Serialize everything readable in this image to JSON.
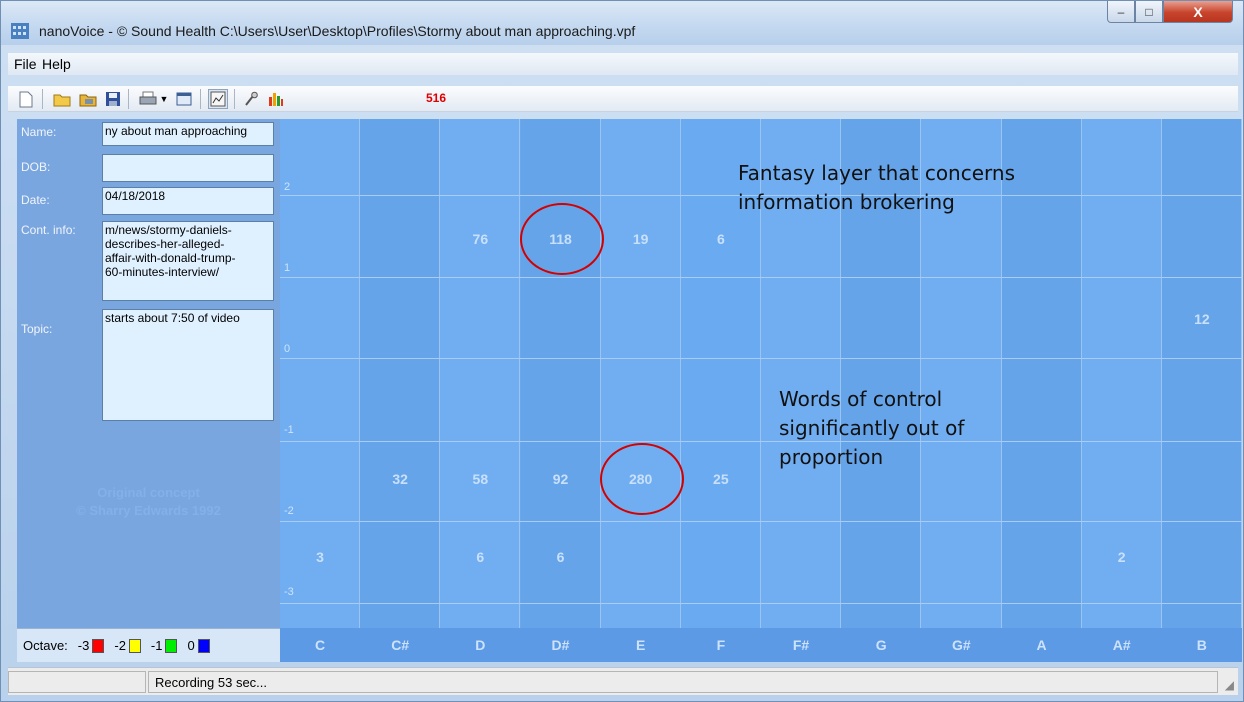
{
  "window": {
    "title": "nanoVoice - © Sound Health C:\\Users\\User\\Desktop\\Profiles\\Stormy about man approaching.vpf",
    "min_symbol": "–",
    "max_symbol": "□",
    "close_symbol": "X"
  },
  "menu": {
    "file": "File",
    "help": "Help"
  },
  "toolbar": {
    "count": "516",
    "icons": [
      "new-icon",
      "open-icon",
      "open-folder-icon",
      "save-icon",
      "print-icon",
      "dropdown-icon",
      "window-icon",
      "chart-view-icon",
      "microphone-icon",
      "bar-chart-icon"
    ]
  },
  "profile": {
    "labels": {
      "name": "Name:",
      "dob": "DOB:",
      "date": "Date:",
      "cont": "Cont. info:",
      "topic": "Topic:"
    },
    "name": "ny about man approaching",
    "dob": "",
    "date": "04/18/2018",
    "cont_info": "m/news/stormy-daniels-\ndescribes-her-alleged-\naffair-with-donald-trump-\n60-minutes-interview/",
    "topic": "starts about 7:50 of video",
    "concept_line1": "Original concept",
    "concept_line2": "© Sharry Edwards 1992"
  },
  "octave": {
    "label": "Octave:",
    "items": [
      {
        "label": "-3",
        "color": "#ff0000"
      },
      {
        "label": "-2",
        "color": "#ffff00"
      },
      {
        "label": "-1",
        "color": "#00ee00"
      },
      {
        "label": "0",
        "color": "#0000ff"
      }
    ]
  },
  "grid": {
    "notes": [
      "C",
      "C#",
      "D",
      "D#",
      "E",
      "F",
      "F#",
      "G",
      "G#",
      "A",
      "A#",
      "B"
    ],
    "y_ticks": [
      "2",
      "1",
      "0",
      "-1",
      "-2",
      "-3"
    ],
    "rows": {
      "r1": [
        "",
        "",
        "76",
        "118",
        "19",
        "6",
        "",
        "",
        "",
        "",
        "",
        ""
      ],
      "r2": [
        "",
        "",
        "",
        "",
        "",
        "",
        "",
        "",
        "",
        "",
        "",
        "12"
      ],
      "r3": [
        "",
        "32",
        "58",
        "92",
        "280",
        "25",
        "",
        "",
        "",
        "",
        "",
        ""
      ],
      "r4": [
        "3",
        "",
        "6",
        "6",
        "",
        "",
        "",
        "",
        "",
        "",
        "2",
        ""
      ]
    }
  },
  "annotations": {
    "fantasy": "Fantasy layer that concerns\ninformation brokering",
    "control": "Words of control\nsignificantly out of\nproportion"
  },
  "status": {
    "pane1": "",
    "pane2": "Recording 53 sec..."
  }
}
